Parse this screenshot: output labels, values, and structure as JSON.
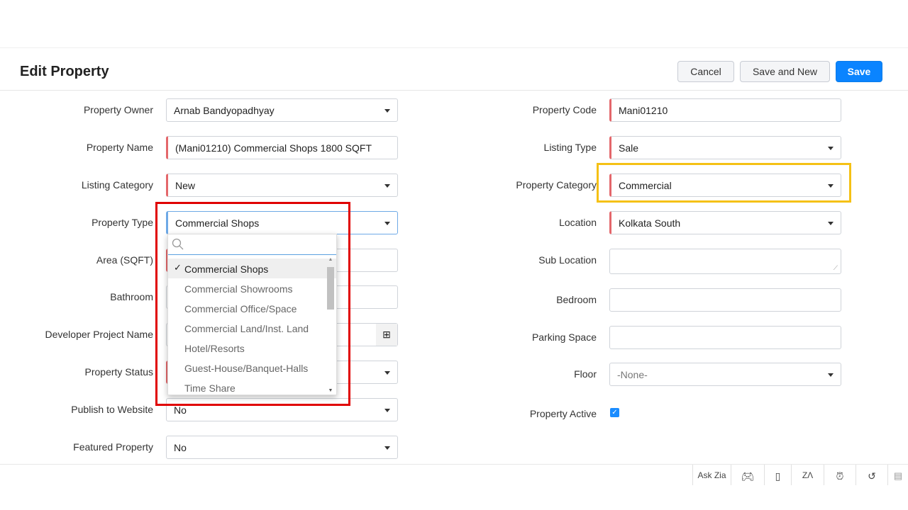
{
  "header": {
    "title": "Edit Property",
    "cancel": "Cancel",
    "save_new": "Save and New",
    "save": "Save"
  },
  "left": [
    {
      "label": "Property Owner",
      "value": "Arnab Bandyopadhyay",
      "type": "select",
      "required": false
    },
    {
      "label": "Property Name",
      "value": "(Mani01210) Commercial Shops 1800 SQFT",
      "type": "text",
      "required": true
    },
    {
      "label": "Listing Category",
      "value": "New",
      "type": "select",
      "required": true
    },
    {
      "label": "Property Type",
      "value": "Commercial Shops",
      "type": "select",
      "required": true
    },
    {
      "label": "Area (SQFT)",
      "value": "",
      "type": "text",
      "required": true
    },
    {
      "label": "Bathroom",
      "value": "",
      "type": "text",
      "required": false
    },
    {
      "label": "Developer Project Name",
      "value": "",
      "type": "lookup",
      "required": false
    },
    {
      "label": "Property Status",
      "value": "",
      "type": "select",
      "required": true
    },
    {
      "label": "Publish to Website",
      "value": "No",
      "type": "select",
      "required": false
    },
    {
      "label": "Featured Property",
      "value": "No",
      "type": "select",
      "required": false
    }
  ],
  "right": [
    {
      "label": "Property Code",
      "value": "Mani01210",
      "type": "text",
      "required": true
    },
    {
      "label": "Listing Type",
      "value": "Sale",
      "type": "select",
      "required": true
    },
    {
      "label": "Property Category",
      "value": "Commercial",
      "type": "select",
      "required": true
    },
    {
      "label": "Location",
      "value": "Kolkata South",
      "type": "select",
      "required": true
    },
    {
      "label": "Sub Location",
      "value": "",
      "type": "textarea",
      "required": false
    },
    {
      "label": "Bedroom",
      "value": "",
      "type": "text",
      "required": false
    },
    {
      "label": "Parking Space",
      "value": "",
      "type": "text",
      "required": false
    },
    {
      "label": "Floor",
      "value": "-None-",
      "type": "select",
      "required": false
    },
    {
      "label": "Property Active",
      "value": "checked",
      "type": "checkbox",
      "required": false
    }
  ],
  "dropdown": {
    "search_placeholder": "",
    "options": [
      "Commercial Shops",
      "Commercial Showrooms",
      "Commercial Office/Space",
      "Commercial Land/Inst. Land",
      "Hotel/Resorts",
      "Guest-House/Banquet-Halls",
      "Time Share"
    ],
    "selected": "Commercial Shops"
  },
  "footer": {
    "ask_zia": "Ask Zia",
    "icons": [
      "gamepad-icon",
      "notes-icon",
      "zia-icon",
      "alarm-icon",
      "history-icon",
      "trash-icon"
    ]
  },
  "colors": {
    "accent": "#0a84ff",
    "required": "#e4676b",
    "highlight_red": "#e00000",
    "highlight_yellow": "#f5c115"
  }
}
